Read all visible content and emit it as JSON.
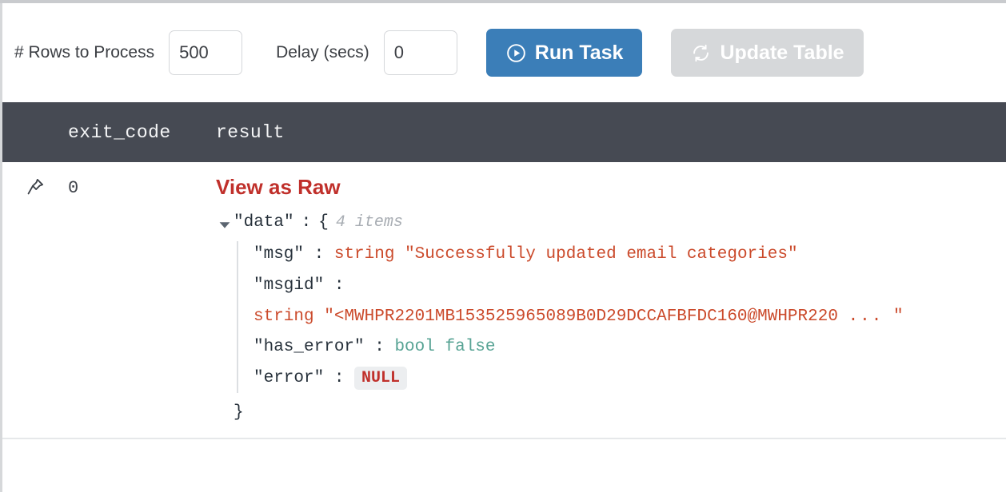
{
  "toolbar": {
    "rows_label": "# Rows to Process",
    "rows_value": "500",
    "rows_placeholder": "",
    "delay_label": "Delay (secs)",
    "delay_value": "0",
    "delay_placeholder": "",
    "run_button": "Run Task",
    "run_icon": "play-circle-icon",
    "update_button": "Update Table",
    "update_icon": "refresh-icon",
    "accent_blue": "#3b7eb8",
    "disabled_gray": "#d6d8da"
  },
  "table": {
    "columns": [
      "exit_code",
      "result"
    ],
    "header_bg": "#464a53",
    "row": {
      "pin_icon": "pin-icon",
      "exit_code": "0",
      "raw_link": "View as Raw",
      "raw_link_color": "#c0302b"
    }
  },
  "json_viewer": {
    "root_key": "\"data\"",
    "root_colon": ":",
    "root_open": "{",
    "items_hint": "4 items",
    "close_brace": "}",
    "entries": [
      {
        "key": "\"msg\"",
        "colon": ":",
        "type": "string",
        "value": "\"Successfully updated email categories\"",
        "wrapped": false
      },
      {
        "key": "\"msgid\"",
        "colon": ":",
        "type": "string",
        "value": "\"<MWHPR2201MB153525965089B0D29DCCAFBFDC160@MWHPR220",
        "value_ellipsis": "...",
        "value_close": "\"",
        "wrapped": true
      },
      {
        "key": "\"has_error\"",
        "colon": ":",
        "type": "bool",
        "value": "false",
        "wrapped": false
      },
      {
        "key": "\"error\"",
        "colon": ":",
        "type": "null",
        "value": "NULL",
        "wrapped": false
      }
    ]
  }
}
